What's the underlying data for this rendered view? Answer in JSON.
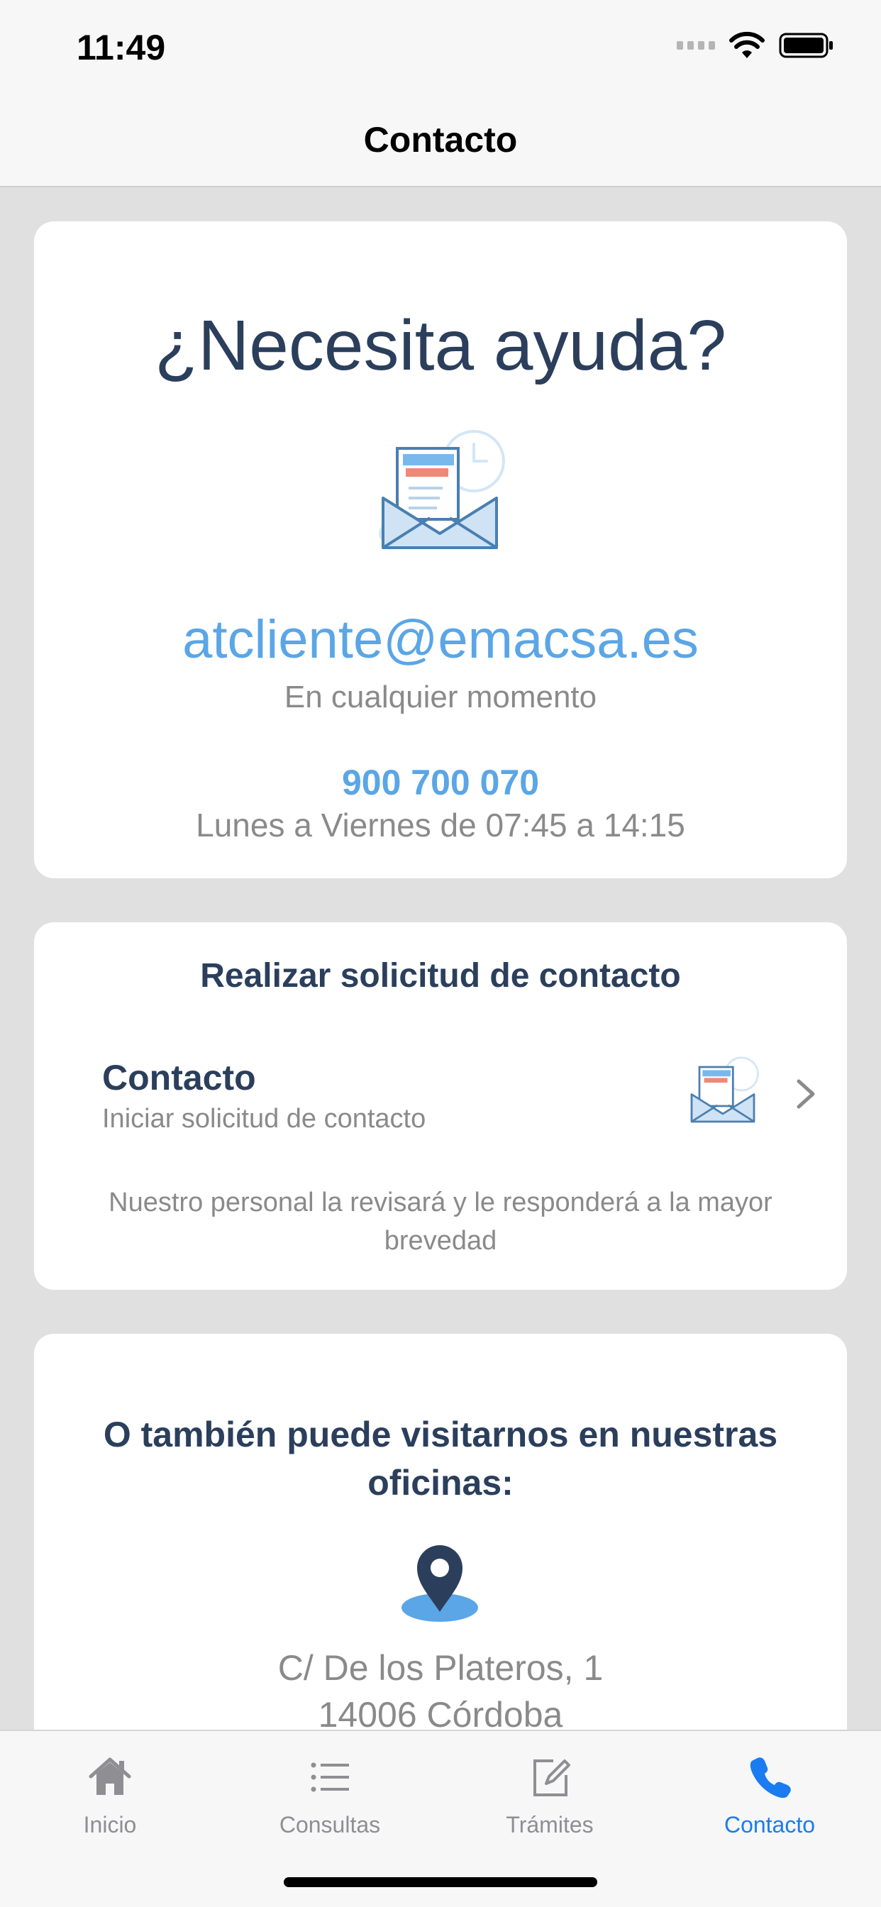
{
  "status": {
    "time": "11:49"
  },
  "nav": {
    "title": "Contacto"
  },
  "help_card": {
    "title": "¿Necesita ayuda?",
    "illustration_icon": "mail-envelope-icon",
    "email": "atcliente@emacsa.es",
    "email_note": "En cualquier momento",
    "phone": "900 700 070",
    "phone_hours": "Lunes a Viernes de 07:45 a 14:15"
  },
  "request_card": {
    "title": "Realizar solicitud de contacto",
    "item_title": "Contacto",
    "item_subtitle": "Iniciar solicitud de contacto",
    "note": "Nuestro personal la revisará y le responderá a la mayor brevedad"
  },
  "office_card": {
    "title": "O también puede visitarnos en nuestras oficinas:",
    "icon": "map-pin-icon",
    "address_line1": "C/ De los Plateros, 1",
    "address_line2": "14006 Córdoba"
  },
  "tabs": [
    {
      "label": "Inicio",
      "icon": "home-icon",
      "active": false
    },
    {
      "label": "Consultas",
      "icon": "list-icon",
      "active": false
    },
    {
      "label": "Trámites",
      "icon": "edit-icon",
      "active": false
    },
    {
      "label": "Contacto",
      "icon": "phone-icon",
      "active": true
    }
  ],
  "colors": {
    "accent": "#1a7cf0",
    "link": "#5aa6e6",
    "heading": "#2b3f5c",
    "muted": "#8a8a8a",
    "background": "#e0e0e0"
  }
}
